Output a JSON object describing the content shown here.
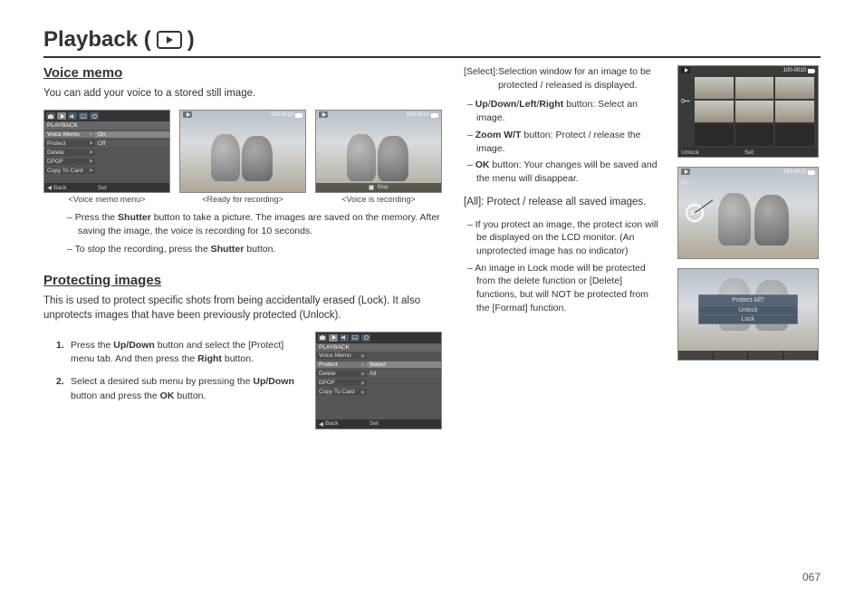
{
  "page": {
    "title_prefix": "Playback (",
    "title_suffix": ")",
    "number": "067"
  },
  "voice_memo": {
    "heading": "Voice memo",
    "intro": "You can add your voice to a stored still image.",
    "captions": {
      "menu": "<Voice memo menu>",
      "ready": "<Ready for recording>",
      "recording": "<Voice is recording>"
    },
    "menu": {
      "header": "PLAYBACK",
      "rows": [
        {
          "label": "Voice Memo",
          "value": "On"
        },
        {
          "label": "Protect",
          "value": "Off"
        },
        {
          "label": "Delete",
          "value": ""
        },
        {
          "label": "DPOF",
          "value": ""
        },
        {
          "label": "Copy To Card",
          "value": ""
        }
      ],
      "back": "Back",
      "set": "Set"
    },
    "photo_counter": "100-0010",
    "stop_label": "Stop",
    "bullets": {
      "b1_pre": "Press the ",
      "b1_shutter": "Shutter",
      "b1_post": " button to take a picture. The images are saved on the memory. After saving the image, the voice is recording for 10 seconds.",
      "b2_pre": "To stop the recording, press the ",
      "b2_shutter": "Shutter",
      "b2_post": " button."
    }
  },
  "protecting": {
    "heading": "Protecting images",
    "intro": "This is used to protect specific shots from being accidentally erased (Lock). It also unprotects images that have been previously protected (Unlock).",
    "steps": {
      "s1_pre": "Press the ",
      "s1_updown": "Up/Down",
      "s1_mid": " button and select the [Protect] menu tab. And then press the ",
      "s1_right": "Right",
      "s1_post": " button.",
      "s2_pre": "Select a desired sub menu by pressing the ",
      "s2_updown": "Up/Down",
      "s2_mid": " button and press the ",
      "s2_ok": "OK",
      "s2_post": " button."
    },
    "menu": {
      "header": "PLAYBACK",
      "rows": [
        {
          "label": "Voice Memo",
          "value": ""
        },
        {
          "label": "Protect",
          "value": "Select"
        },
        {
          "label": "Delete",
          "value": "All"
        },
        {
          "label": "DPOF",
          "value": ""
        },
        {
          "label": "Copy To Card",
          "value": ""
        }
      ],
      "back": "Back",
      "set": "Set"
    },
    "right_col": {
      "select_label": "[Select]:",
      "select_text": " Selection window for an image to be protected / released is displayed.",
      "udlr_pre": "Up",
      "udlr_s1": "/",
      "udlr_down": "Down",
      "udlr_s2": "/",
      "udlr_left": "Left",
      "udlr_s3": "/",
      "udlr_right": "Right",
      "udlr_post": " button: Select an image.",
      "zoom_pre": "Zoom W/T",
      "zoom_post": " button:  Protect / release the image.",
      "ok_pre": "OK",
      "ok_post": " button: Your changes will be saved and the menu will disappear.",
      "all_label": "[All]: Protect / release all saved images.",
      "b_protect": "If you protect an image, the protect icon will be displayed on the LCD monitor. (An unprotected image has no indicator)",
      "b_lock": "An image in Lock mode will be protected from the delete function or [Delete] functions, but will NOT be protected from the [Format] function."
    },
    "grid_bottom": {
      "unlock": "Unlock",
      "set": "Set"
    },
    "dialog": {
      "title": "Protect All?",
      "opt1": "Unlock",
      "opt2": "Lock"
    }
  }
}
